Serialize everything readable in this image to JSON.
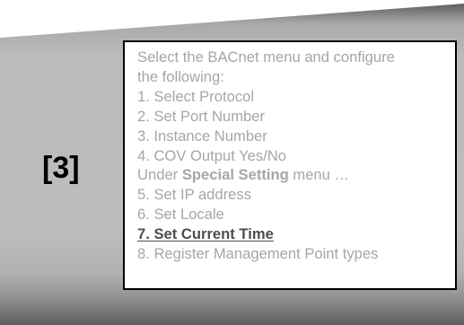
{
  "slide": {
    "step_label": "[3]",
    "instructions": {
      "intro_line1": "Select the BACnet menu and configure",
      "intro_line2": "the following:",
      "items": [
        "1. Select Protocol",
        "2. Set Port Number",
        "3. Instance Number",
        "4. COV Output Yes/No"
      ],
      "special_prefix": "Under ",
      "special_bold": "Special Setting",
      "special_suffix": " menu …",
      "special_items": [
        "5. Set IP address",
        "6. Set Locale"
      ],
      "current_item": "7. Set Current Time",
      "last_item": "8. Register Management Point types"
    }
  },
  "colors": {
    "text_dim": "#a6a6a6",
    "text_current": "#4d4d4d",
    "panel_gray": "#bdbdbd",
    "border": "#000000"
  }
}
